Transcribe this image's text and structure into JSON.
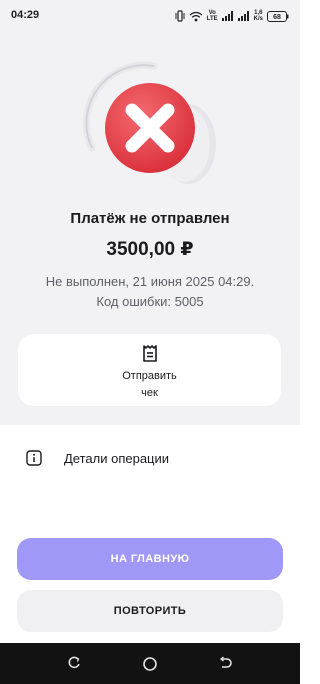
{
  "status_bar": {
    "time": "04:29",
    "net_label_top": "Vo",
    "net_label_bottom": "LTE",
    "speed_value": "1,6",
    "speed_unit": "K/s",
    "battery_level": "68",
    "icons": [
      "vibrate-icon",
      "wifi-icon",
      "signal-icon",
      "signal-icon",
      "battery-icon"
    ]
  },
  "hero": {
    "icon": "error-x-icon",
    "colors": {
      "error_red": "#e23b45",
      "disc": "#e4e4e8"
    }
  },
  "payment": {
    "title": "Платёж не отправлен",
    "amount": "3500,00 ₽",
    "status_line": "Не выполнен, 21 июня 2025 04:29.",
    "error_code_line": "Код ошибки: 5005"
  },
  "receipt": {
    "icon": "receipt-icon",
    "label": "Отправить\nчек"
  },
  "details": {
    "icon": "info-icon",
    "label": "Детали операции"
  },
  "buttons": {
    "home_label": "НА ГЛАВНУЮ",
    "retry_label": "ПОВТОРИТЬ"
  },
  "colors": {
    "accent": "#9f98f7",
    "background": "#f2f2f5"
  },
  "nav_bar": {
    "icons": [
      "recent-apps-icon",
      "home-icon",
      "back-icon"
    ]
  }
}
